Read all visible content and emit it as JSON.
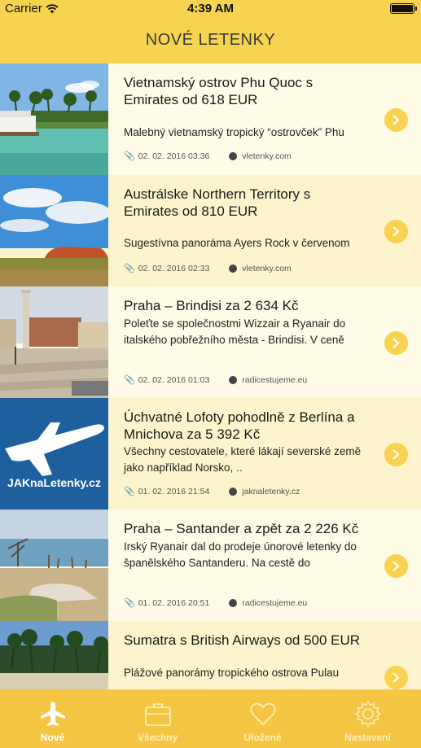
{
  "status_bar": {
    "carrier": "Carrier",
    "time": "4:39 AM"
  },
  "navbar": {
    "title": "NOVÉ LETENKY"
  },
  "items": [
    {
      "title": "Vietnamský ostrov Phu Quoc s Emirates od 618 EUR",
      "description": "Malebný vietnamský tropický “ostrovček” Phu",
      "date": "02. 02. 2016 03:36",
      "source": "vletenky.com"
    },
    {
      "title": "Austrálske Northern Territory s Emirates od 810 EUR",
      "description": "Sugestívna panoráma Ayers Rock v červenom",
      "date": "02. 02. 2016 02:33",
      "source": "vletenky.com"
    },
    {
      "title": "Praha – Brindisi za 2 634 Kč",
      "description": "Poleťte se společnostmi  Wizzair a Ryanair do italského pobřežního města - Brindisi. V ceně",
      "date": "02. 02. 2016 01:03",
      "source": "radicestujeme.eu"
    },
    {
      "title": "Úchvatné Lofoty pohodlně z Berlína a Mnichova za 5 392 Kč",
      "description": "Všechny cestovatele, které lákají severské země jako například Norsko, ..",
      "date": "01. 02. 2016 21:54",
      "source": "jaknaletenky.cz",
      "thumb_text": "JAKnaLetenky.cz"
    },
    {
      "title": "Praha – Santander a zpět za 2 226 Kč",
      "description": "Irský Ryanair dal do prodeje únorové letenky do španělského Santanderu. Na cestě do",
      "date": "01. 02. 2016 20:51",
      "source": "radicestujeme.eu"
    },
    {
      "title": "Sumatra s British Airways od 500 EUR",
      "description": "Plážové panorámy tropického ostrova Pulau",
      "date": "",
      "source": ""
    }
  ],
  "tabs": [
    {
      "label": "Nové",
      "icon": "plane-icon",
      "active": true
    },
    {
      "label": "Všechny",
      "icon": "suitcase-icon",
      "active": false
    },
    {
      "label": "Uložené",
      "icon": "heart-icon",
      "active": false
    },
    {
      "label": "Nastavení",
      "icon": "gear-icon",
      "active": false
    }
  ],
  "colors": {
    "accent": "#f7d34f",
    "tabbar": "#f5c544",
    "row_light": "#fefbe6",
    "row_dark": "#fdf4cd"
  }
}
